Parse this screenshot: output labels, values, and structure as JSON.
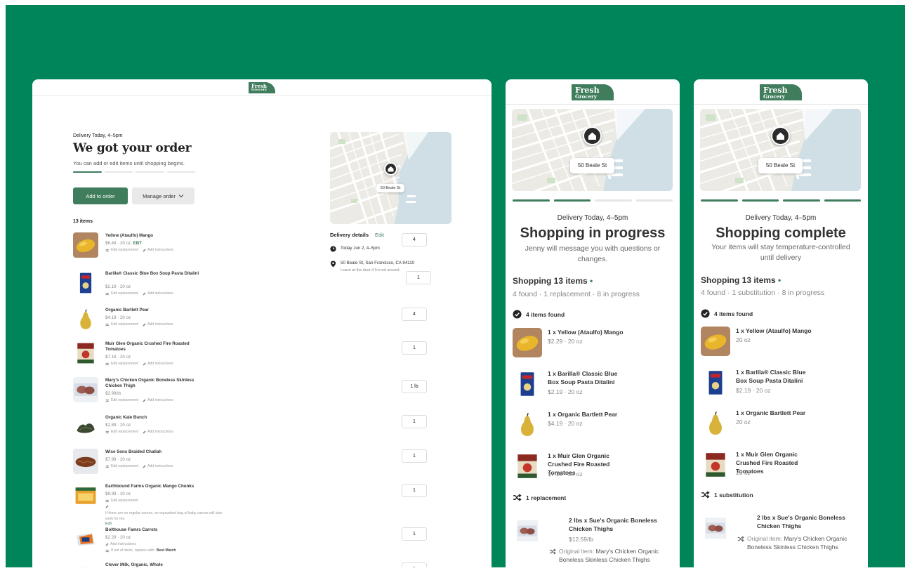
{
  "colors": {
    "background": "#00845a",
    "brand": "#3f7d5c",
    "card": "#ffffff"
  },
  "brand": {
    "line1": "Fresh",
    "line2": "Grocery"
  },
  "desktop": {
    "kicker": "Delivery Today, 4–5pm",
    "title": "We got your order",
    "subtitle": "You can add or edit items until shopping begins.",
    "progress": {
      "completed_steps": 1,
      "total_steps": 4
    },
    "add_button": "Add to order",
    "manage_button": "Manage order",
    "item_count": "13 items",
    "map_address": "50 Beale St",
    "delivery_details_label": "Delivery details",
    "delivery_edit": "Edit",
    "delivery_time": "Today Jun 2, 4–5pm",
    "delivery_address": "50 Beale St, San Francisco, CA 94110",
    "delivery_note": "Leave at the door if I'm not around",
    "actions": {
      "replacement": "Edit replacement",
      "instructions": "Edit instructions",
      "add_instructions": "Add instructions"
    },
    "items": [
      {
        "name": "Yellow (Ataulfo) Mango",
        "meta": "$6.49 · 20 oz,",
        "badge": "EBT",
        "qty": "4",
        "img": "mango"
      },
      {
        "name": "Barilla® Classic Blue Box Soup Pasta Ditalini",
        "meta": "$2.19 · 20 oz",
        "qty": "1",
        "img": "pasta"
      },
      {
        "name": "Organic Bartlett Pear",
        "meta": "$4.19 · 20 oz",
        "qty": "4",
        "img": "pear"
      },
      {
        "name": "Muir Glen Organic Crushed Fire Roasted Tomatoes",
        "meta": "$7.18 · 20 oz",
        "qty": "1",
        "img": "tomato"
      },
      {
        "name": "Mary's Chicken Organic Boneless Skinless Chicken Thigh",
        "meta": "$2.99/lb",
        "qty": "1 lb",
        "img": "chicken"
      },
      {
        "name": "Organic Kale Bunch",
        "meta": "$2.89 · 20 oz",
        "qty": "1",
        "img": "kale"
      },
      {
        "name": "Wise Sons Braided Challah",
        "meta": "$7.99 · 20 oz",
        "qty": "1",
        "img": "challah"
      },
      {
        "name": "Earthbound Farms Organic Mango Chunks",
        "meta": "$9.99 · 20 oz",
        "qty": "1",
        "img": "chunks",
        "note": "If there are no regular carrots, an equivalent bag of baby carrots will also work for me.",
        "note_edit": "Edit"
      },
      {
        "name": "Bolthouse Famrs Carrots",
        "meta": "$2.29 · 20 oz",
        "qty": "1",
        "img": "carrots",
        "note": "If out of stock, replace with:",
        "note_value": "Best Match"
      },
      {
        "name": "Clover Milk, Organic, Whole",
        "qty": "1",
        "img": "milk"
      }
    ]
  },
  "mobile_progress": {
    "kicker": "Delivery Today, 4–5pm",
    "title": "Shopping in progress",
    "subtitle": "Jenny will message you with questions or changes.",
    "progress": {
      "completed_steps": 2,
      "total_steps": 4
    },
    "map_address": "50 Beale St",
    "shopping_label": "Shopping 13 items",
    "dot": "•",
    "stats": "4 found · 1 replacement · 8 in progress",
    "found_label": "4 items found",
    "found": [
      {
        "name": "1 x Yellow (Ataulfo) Mango",
        "meta": "$2.29 · 20 oz",
        "img": "mango"
      },
      {
        "name": "1 x Barilla® Classic Blue Box Soup Pasta Ditalini",
        "meta": "$2.19 · 20 oz",
        "img": "pasta"
      },
      {
        "name": "1 x Organic Bartlett Pear",
        "meta": "$4.19 · 20 oz",
        "img": "pear"
      },
      {
        "name": "1 x Muir Glen Organic Crushed Fire Roasted Tomatoes",
        "meta": "$7.18 · 20 oz",
        "img": "tomato"
      }
    ],
    "replacement_label": "1 replacement",
    "replacement": {
      "name": "2 lbs x Sue's Organic Boneless Chicken Thighs",
      "meta": "$12.59/lb",
      "original_prefix": "Original item:",
      "original_name": "Mary's Chicken Organic Boneless Skinless Chicken Thighs"
    }
  },
  "mobile_complete": {
    "kicker": "Delivery Today, 4–5pm",
    "title": "Shopping complete",
    "subtitle": "Your items will stay temperature-controlled until delivery",
    "progress": {
      "completed_steps": 4,
      "total_steps": 4
    },
    "map_address": "50 Beale St",
    "shopping_label": "Shopping 13 items",
    "dot": "•",
    "stats": "4 found · 1 substitution · 8 in progress",
    "found_label": "4 items found",
    "found": [
      {
        "name": "1 x Yellow (Ataulfo) Mango",
        "meta": "20 oz",
        "img": "mango"
      },
      {
        "name": "1 x Barilla® Classic Blue Box Soup Pasta Ditalini",
        "meta": "$2.19 · 20 oz",
        "img": "pasta"
      },
      {
        "name": "1 x Organic Bartlett Pear",
        "meta": "20 oz",
        "img": "pear"
      },
      {
        "name": "1 x Muir Glen Organic Crushed Fire Roasted Tomatoes",
        "meta": "20 oz",
        "img": "tomato"
      }
    ],
    "substitution_label": "1 substitution",
    "substitution": {
      "name": "2 lbs x Sue's Organic Boneless Chicken Thighs",
      "original_prefix": "Original item:",
      "original_name": "Mary's Chicken Organic Boneless Skinless Chicken Thighs"
    }
  }
}
